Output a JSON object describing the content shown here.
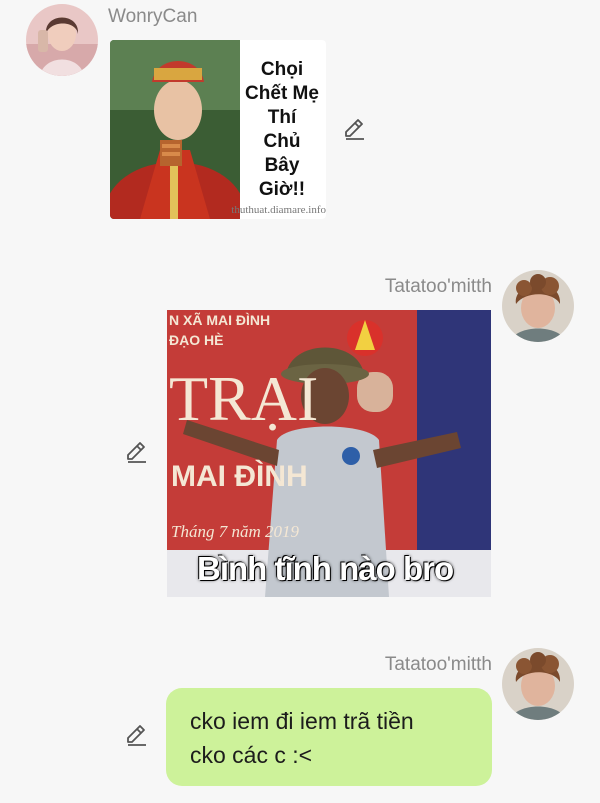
{
  "messages": [
    {
      "sender": "WonryCan",
      "side": "left",
      "type": "image",
      "image_caption": "Chọi\nChết Mẹ\nThí\nChủ\nBây\nGiờ!!",
      "watermark": "thuthuat.diamare.info"
    },
    {
      "sender": "Tatatoo'mitth",
      "side": "right",
      "type": "image",
      "image_banner_top": "N XÃ MAI ĐÌNH",
      "image_banner_sub": "ĐẠO HÈ",
      "image_banner_big": "TRẠI",
      "image_banner_mid": "MAI ĐÌNH",
      "image_date": "Tháng 7 năm 2019",
      "image_caption": "Bình tĩnh nào bro"
    },
    {
      "sender": "Tatatoo'mitth",
      "side": "right",
      "type": "text",
      "text": "cko iem đi iem trã tiền\ncko các c :<"
    }
  ],
  "colors": {
    "background": "#f7f7f7",
    "bubble_green": "#cdf29a",
    "name_gray": "#8a8a8a"
  },
  "icons": {
    "edit": "pencil-icon"
  }
}
